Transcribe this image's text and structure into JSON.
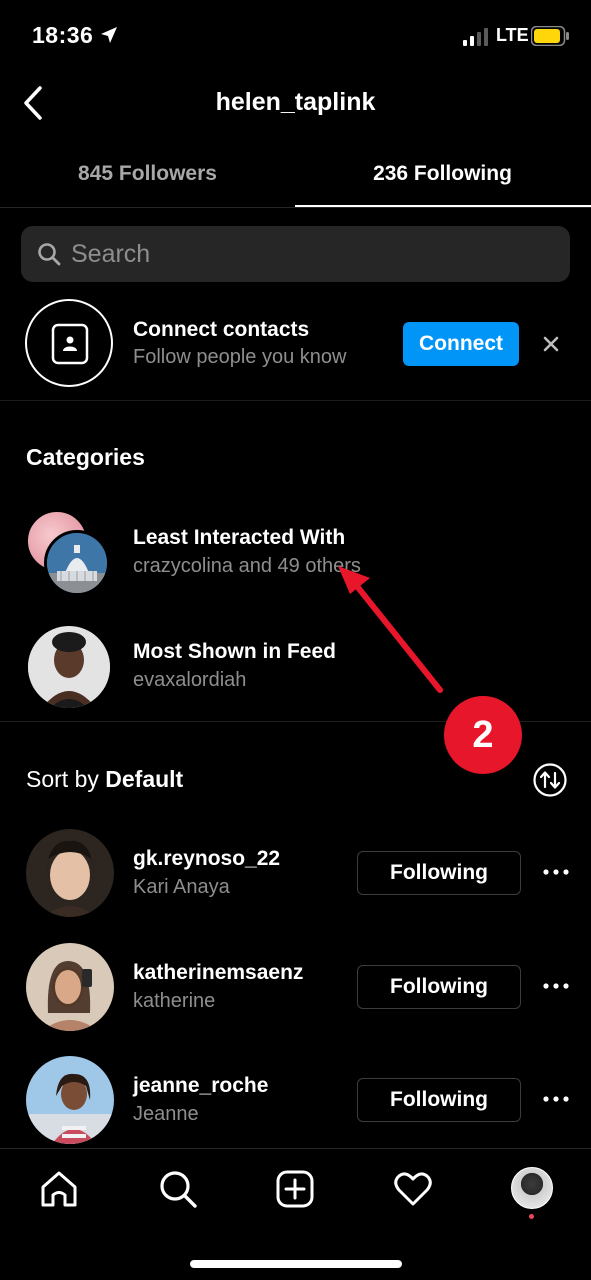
{
  "status_bar": {
    "time": "18:36",
    "network": "LTE",
    "icons": [
      "location-arrow-icon",
      "signal-icon",
      "battery-icon"
    ]
  },
  "header": {
    "title": "helen_taplink",
    "back_icon": "chevron-left-icon"
  },
  "tabs": [
    {
      "label": "845 Followers",
      "active": false
    },
    {
      "label": "236 Following",
      "active": true
    }
  ],
  "search": {
    "placeholder": "Search",
    "icon": "search-icon"
  },
  "connect_contacts": {
    "title": "Connect contacts",
    "subtitle": "Follow people you know",
    "button_label": "Connect",
    "icon": "contact-card-icon",
    "dismiss_icon": "close-icon"
  },
  "categories": {
    "heading": "Categories",
    "items": [
      {
        "title": "Least Interacted With",
        "subtitle": "crazycolina and 49 others"
      },
      {
        "title": "Most Shown in Feed",
        "subtitle": "evaxalordiah"
      }
    ]
  },
  "annotation": {
    "step_number": "2",
    "color": "#e8162a"
  },
  "sort": {
    "prefix": "Sort by ",
    "value": "Default",
    "icon": "sort-arrows-icon"
  },
  "users": [
    {
      "username": "gk.reynoso_22",
      "name": "Kari Anaya",
      "button_label": "Following"
    },
    {
      "username": "katherinemsaenz",
      "name": "katherine",
      "button_label": "Following"
    },
    {
      "username": "jeanne_roche",
      "name": "Jeanne",
      "button_label": "Following"
    }
  ],
  "bottom_nav": [
    "home-icon",
    "search-icon",
    "add-post-icon",
    "heart-icon",
    "profile-avatar"
  ],
  "colors": {
    "background": "#000000",
    "accent": "#0095f6",
    "secondary_text": "#8e8e8e",
    "notification_dot": "#ed4956"
  }
}
